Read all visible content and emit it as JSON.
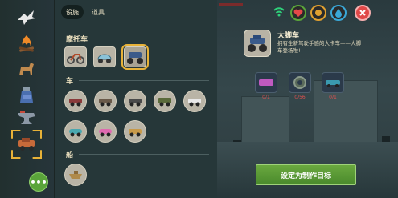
{
  "tabs": [
    {
      "label": "设施",
      "active": true
    },
    {
      "label": "道具",
      "active": false
    }
  ],
  "sections": {
    "motorcycle": {
      "title": "摩托车"
    },
    "car": {
      "title": "车"
    },
    "boat": {
      "title": "船"
    }
  },
  "detail": {
    "title": "大脚车",
    "description": "拥有全新驾驶手感的大卡车——大脚车登场啦!",
    "requirements": [
      {
        "count": "0/1",
        "color": "#d64848"
      },
      {
        "count": "0/56",
        "color": "#d64848"
      },
      {
        "count": "0/1",
        "color": "#d64848"
      }
    ]
  },
  "craft_button": {
    "label": "设定为制作目标"
  },
  "more_button": {
    "label": "•••"
  },
  "status": {
    "signal_color": "#2fd07a",
    "heart_color": "#e44848",
    "food_color": "#e0a030",
    "water_color": "#3aa8d8",
    "close_color": "#e04848"
  },
  "icons": {
    "left_categories": [
      "bird-icon",
      "campfire-icon",
      "horse-icon",
      "potion-icon",
      "anvil-icon",
      "vehicle-icon"
    ],
    "selected_category": "vehicle-icon"
  }
}
